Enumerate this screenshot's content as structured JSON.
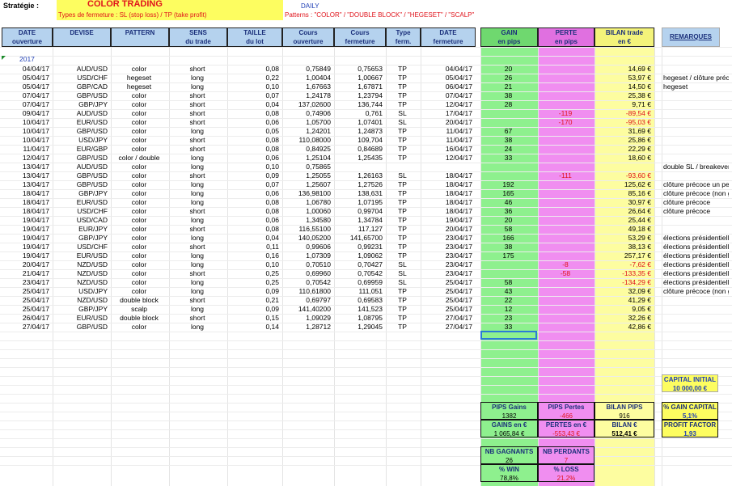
{
  "header": {
    "strategie_label": "Stratégie :",
    "title": "COLOR TRADING",
    "subtitle": "Types de fermeture : SL (stop loss) / TP (take profit)",
    "period": "DAILY",
    "patterns": "Patterns : \"COLOR\" / \"DOUBLE BLOCK\" / \"HEGESET\" / \"SCALP\"",
    "year": "2017"
  },
  "columns": {
    "date_ouv": [
      "DATE",
      "ouverture"
    ],
    "devise": [
      "DEVISE",
      ""
    ],
    "pattern": [
      "PATTERN",
      ""
    ],
    "sens": [
      "SENS",
      "du trade"
    ],
    "taille": [
      "TAILLE",
      "du lot"
    ],
    "cours_ouv": [
      "Cours",
      "ouverture"
    ],
    "cours_ferm": [
      "Cours",
      "fermeture"
    ],
    "type": [
      "Type",
      "ferm."
    ],
    "date_ferm": [
      "DATE",
      "fermeture"
    ],
    "gain": [
      "GAIN",
      "en pips"
    ],
    "perte": [
      "PERTE",
      "en pips"
    ],
    "bilan": [
      "BILAN trade",
      "en €"
    ],
    "remarques": [
      "REMARQUES",
      ""
    ]
  },
  "trades": [
    {
      "d": "04/04/17",
      "dev": "AUD/USD",
      "pat": "color",
      "sens": "short",
      "t": "0,08",
      "co": "0,75849",
      "cf": "0,75653",
      "tp": "TP",
      "df": "04/04/17",
      "g": "20",
      "p": "",
      "b": "14,69 €",
      "rem": ""
    },
    {
      "d": "05/04/17",
      "dev": "USD/CHF",
      "pat": "hegeset",
      "sens": "long",
      "t": "0,22",
      "co": "1,00404",
      "cf": "1,00667",
      "tp": "TP",
      "df": "05/04/17",
      "g": "26",
      "p": "",
      "b": "53,97 €",
      "rem": "hegeset / clôture préc"
    },
    {
      "d": "05/04/17",
      "dev": "GBP/CAD",
      "pat": "hegeset",
      "sens": "long",
      "t": "0,10",
      "co": "1,67663",
      "cf": "1,67871",
      "tp": "TP",
      "df": "06/04/17",
      "g": "21",
      "p": "",
      "b": "14,50 €",
      "rem": "hegeset"
    },
    {
      "d": "07/04/17",
      "dev": "GBP/USD",
      "pat": "color",
      "sens": "short",
      "t": "0,07",
      "co": "1,24178",
      "cf": "1,23794",
      "tp": "TP",
      "df": "07/04/17",
      "g": "38",
      "p": "",
      "b": "25,38 €",
      "rem": ""
    },
    {
      "d": "07/04/17",
      "dev": "GBP/JPY",
      "pat": "color",
      "sens": "short",
      "t": "0,04",
      "co": "137,02600",
      "cf": "136,744",
      "tp": "TP",
      "df": "12/04/17",
      "g": "28",
      "p": "",
      "b": "9,71 €",
      "rem": ""
    },
    {
      "d": "09/04/17",
      "dev": "AUD/USD",
      "pat": "color",
      "sens": "short",
      "t": "0,08",
      "co": "0,74906",
      "cf": "0,761",
      "tp": "SL",
      "df": "17/04/17",
      "g": "",
      "p": "-119",
      "b": "-89,54 €",
      "rem": ""
    },
    {
      "d": "10/04/17",
      "dev": "EUR/USD",
      "pat": "color",
      "sens": "short",
      "t": "0,06",
      "co": "1,05700",
      "cf": "1,07401",
      "tp": "SL",
      "df": "20/04/17",
      "g": "",
      "p": "-170",
      "b": "-95,03 €",
      "rem": ""
    },
    {
      "d": "10/04/17",
      "dev": "GBP/USD",
      "pat": "color",
      "sens": "long",
      "t": "0,05",
      "co": "1,24201",
      "cf": "1,24873",
      "tp": "TP",
      "df": "11/04/17",
      "g": "67",
      "p": "",
      "b": "31,69 €",
      "rem": ""
    },
    {
      "d": "10/04/17",
      "dev": "USD/JPY",
      "pat": "color",
      "sens": "short",
      "t": "0,08",
      "co": "110,08000",
      "cf": "109,704",
      "tp": "TP",
      "df": "11/04/17",
      "g": "38",
      "p": "",
      "b": "25,86 €",
      "rem": ""
    },
    {
      "d": "11/04/17",
      "dev": "EUR/GBP",
      "pat": "color",
      "sens": "short",
      "t": "0,08",
      "co": "0,84925",
      "cf": "0,84689",
      "tp": "TP",
      "df": "16/04/17",
      "g": "24",
      "p": "",
      "b": "22,29 €",
      "rem": ""
    },
    {
      "d": "12/04/17",
      "dev": "GBP/USD",
      "pat": "color / double",
      "sens": "long",
      "t": "0,06",
      "co": "1,25104",
      "cf": "1,25435",
      "tp": "TP",
      "df": "12/04/17",
      "g": "33",
      "p": "",
      "b": "18,60 €",
      "rem": ""
    },
    {
      "d": "13/04/17",
      "dev": "AUD/USD",
      "pat": "color",
      "sens": "long",
      "t": "0,10",
      "co": "0,75865",
      "cf": "",
      "tp": "",
      "df": "",
      "g": "",
      "p": "",
      "b": "",
      "rem": "double SL / breakeven"
    },
    {
      "d": "13/04/17",
      "dev": "GBP/USD",
      "pat": "color",
      "sens": "short",
      "t": "0,09",
      "co": "1,25055",
      "cf": "1,26163",
      "tp": "SL",
      "df": "18/04/17",
      "g": "",
      "p": "-111",
      "b": "-93,60 €",
      "rem": ""
    },
    {
      "d": "13/04/17",
      "dev": "GBP/USD",
      "pat": "color",
      "sens": "long",
      "t": "0,07",
      "co": "1,25607",
      "cf": "1,27526",
      "tp": "TP",
      "df": "18/04/17",
      "g": "192",
      "p": "",
      "b": "125,62 €",
      "rem": "clôture précoce un pe"
    },
    {
      "d": "18/04/17",
      "dev": "GBP/JPY",
      "pat": "color",
      "sens": "long",
      "t": "0,06",
      "co": "136,98100",
      "cf": "138,631",
      "tp": "TP",
      "df": "18/04/17",
      "g": "165",
      "p": "",
      "b": "85,16 €",
      "rem": "clôture précoce (non g"
    },
    {
      "d": "18/04/17",
      "dev": "EUR/USD",
      "pat": "color",
      "sens": "long",
      "t": "0,08",
      "co": "1,06780",
      "cf": "1,07195",
      "tp": "TP",
      "df": "18/04/17",
      "g": "46",
      "p": "",
      "b": "30,97 €",
      "rem": "clôture précoce"
    },
    {
      "d": "18/04/17",
      "dev": "USD/CHF",
      "pat": "color",
      "sens": "short",
      "t": "0,08",
      "co": "1,00060",
      "cf": "0,99704",
      "tp": "TP",
      "df": "18/04/17",
      "g": "36",
      "p": "",
      "b": "26,64 €",
      "rem": "clôture précoce"
    },
    {
      "d": "19/04/17",
      "dev": "USD/CAD",
      "pat": "color",
      "sens": "long",
      "t": "0,06",
      "co": "1,34580",
      "cf": "1,34784",
      "tp": "TP",
      "df": "19/04/17",
      "g": "20",
      "p": "",
      "b": "25,44 €",
      "rem": ""
    },
    {
      "d": "19/04/17",
      "dev": "EUR/JPY",
      "pat": "color",
      "sens": "short",
      "t": "0,08",
      "co": "116,55100",
      "cf": "117,127",
      "tp": "TP",
      "df": "20/04/17",
      "g": "58",
      "p": "",
      "b": "49,18 €",
      "rem": ""
    },
    {
      "d": "19/04/17",
      "dev": "GBP/JPY",
      "pat": "color",
      "sens": "long",
      "t": "0,04",
      "co": "140,05200",
      "cf": "141,65700",
      "tp": "TP",
      "df": "23/04/17",
      "g": "166",
      "p": "",
      "b": "53,29 €",
      "rem": "élections présidentiell"
    },
    {
      "d": "19/04/17",
      "dev": "USD/CHF",
      "pat": "color",
      "sens": "short",
      "t": "0,11",
      "co": "0,99606",
      "cf": "0,99231",
      "tp": "TP",
      "df": "23/04/17",
      "g": "38",
      "p": "",
      "b": "38,13 €",
      "rem": "élections présidentiell"
    },
    {
      "d": "19/04/17",
      "dev": "EUR/USD",
      "pat": "color",
      "sens": "long",
      "t": "0,16",
      "co": "1,07309",
      "cf": "1,09062",
      "tp": "TP",
      "df": "23/04/17",
      "g": "175",
      "p": "",
      "b": "257,17 €",
      "rem": "élections présidentiell"
    },
    {
      "d": "20/04/17",
      "dev": "NZD/USD",
      "pat": "color",
      "sens": "long",
      "t": "0,10",
      "co": "0,70510",
      "cf": "0,70427",
      "tp": "SL",
      "df": "23/04/17",
      "g": "",
      "p": "-8",
      "b": "-7,62 €",
      "rem": "élections présidentiell"
    },
    {
      "d": "21/04/17",
      "dev": "NZD/USD",
      "pat": "color",
      "sens": "short",
      "t": "0,25",
      "co": "0,69960",
      "cf": "0,70542",
      "tp": "SL",
      "df": "23/04/17",
      "g": "",
      "p": "-58",
      "b": "-133,35 €",
      "rem": "élections présidentiell"
    },
    {
      "d": "23/04/17",
      "dev": "NZD/USD",
      "pat": "color",
      "sens": "long",
      "t": "0,25",
      "co": "0,70542",
      "cf": "0,69959",
      "tp": "SL",
      "df": "25/04/17",
      "g": "58",
      "p": "",
      "b": "-134,29 €",
      "rem": "élections présidentiell"
    },
    {
      "d": "25/04/17",
      "dev": "USD/JPY",
      "pat": "color",
      "sens": "long",
      "t": "0,09",
      "co": "110,61800",
      "cf": "111,051",
      "tp": "TP",
      "df": "25/04/17",
      "g": "43",
      "p": "",
      "b": "32,09 €",
      "rem": "clôture précoce (non g"
    },
    {
      "d": "25/04/17",
      "dev": "NZD/USD",
      "pat": "double block",
      "sens": "short",
      "t": "0,21",
      "co": "0,69797",
      "cf": "0,69583",
      "tp": "TP",
      "df": "25/04/17",
      "g": "22",
      "p": "",
      "b": "41,29 €",
      "rem": ""
    },
    {
      "d": "25/04/17",
      "dev": "GBP/JPY",
      "pat": "scalp",
      "sens": "long",
      "t": "0,09",
      "co": "141,40200",
      "cf": "141,523",
      "tp": "TP",
      "df": "25/04/17",
      "g": "12",
      "p": "",
      "b": "9,05 €",
      "rem": ""
    },
    {
      "d": "26/04/17",
      "dev": "EUR/USD",
      "pat": "double block",
      "sens": "short",
      "t": "0,15",
      "co": "1,09029",
      "cf": "1,08795",
      "tp": "TP",
      "df": "27/04/17",
      "g": "23",
      "p": "",
      "b": "32,26 €",
      "rem": ""
    },
    {
      "d": "27/04/17",
      "dev": "GBP/USD",
      "pat": "color",
      "sens": "long",
      "t": "0,14",
      "co": "1,28712",
      "cf": "1,29045",
      "tp": "TP",
      "df": "27/04/17",
      "g": "33",
      "p": "",
      "b": "42,86 €",
      "rem": ""
    }
  ],
  "summary": {
    "pips_gains_label": "PIPS Gains",
    "pips_gains": "1382",
    "pips_pertes_label": "PIPS Pertes",
    "pips_pertes": "-466",
    "bilan_pips_label": "BILAN PIPS",
    "bilan_pips": "916",
    "gains_eur_label": "GAINS en €",
    "gains_eur": "1 065,84 €",
    "pertes_eur_label": "PERTES en €",
    "pertes_eur": "-553,43 €",
    "bilan_label": "BILAN €",
    "bilan": "512,41 €",
    "capital_label": "CAPITAL INITIAL",
    "capital": "10 000,00 €",
    "gain_capital_label": "% GAIN CAPITAL",
    "gain_capital": "5,1%",
    "profit_factor_label": "PROFIT FACTOR",
    "profit_factor": "1,93",
    "nb_gagnants_label": "NB GAGNANTS",
    "nb_gagnants": "26",
    "nb_perdants_label": "NB PERDANTS",
    "nb_perdants": "7",
    "win_label": "% WIN",
    "win": "78,8%",
    "loss_label": "% LOSS",
    "loss": "21,2%"
  },
  "colors": {
    "gain_col": "#8ef08e",
    "perte_col": "#f08ef0",
    "bilan_col": "#fdfda0",
    "header": "#b5d2ee",
    "title_bg": "#fdfd60"
  }
}
